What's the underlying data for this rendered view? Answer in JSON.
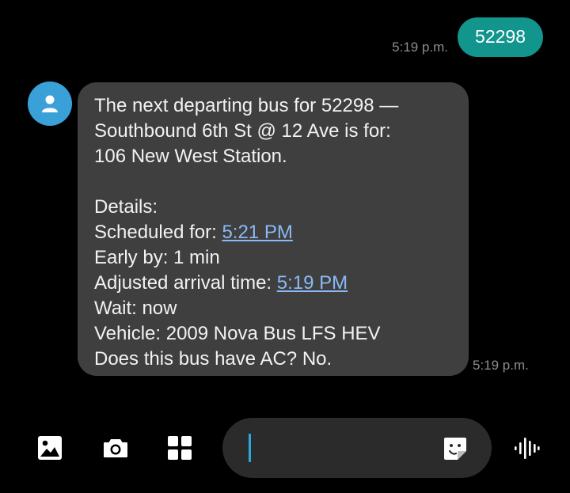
{
  "conversation": {
    "outgoing": {
      "text": "52298",
      "time": "5:19 p.m."
    },
    "incoming": {
      "lines": [
        "The next departing bus for 52298 —",
        "Southbound 6th St @ 12 Ave is for:",
        "106 New West Station."
      ],
      "details_label": "Details:",
      "scheduled_label": "Scheduled for: ",
      "scheduled_time": "5:21 PM",
      "early_by": "Early by: 1 min",
      "adjusted_label": "Adjusted arrival time: ",
      "adjusted_time": "5:19 PM",
      "wait": "Wait: now",
      "vehicle": "Vehicle: 2009 Nova Bus LFS HEV",
      "ac_question": "Does this bus have AC? No.",
      "time": "5:19 p.m."
    }
  },
  "compose": {
    "value": "",
    "placeholder": ""
  },
  "icons": {
    "gallery": "image-icon",
    "camera": "camera-icon",
    "apps": "grid-icon",
    "sticker": "sticker-icon",
    "voice": "voice-waveform-icon"
  },
  "colors": {
    "outgoing_bubble": "#11958d",
    "incoming_bubble": "#3f3f3f",
    "avatar": "#3aa0d8",
    "link": "#8ab9f5",
    "cursor": "#2aa8e0"
  }
}
